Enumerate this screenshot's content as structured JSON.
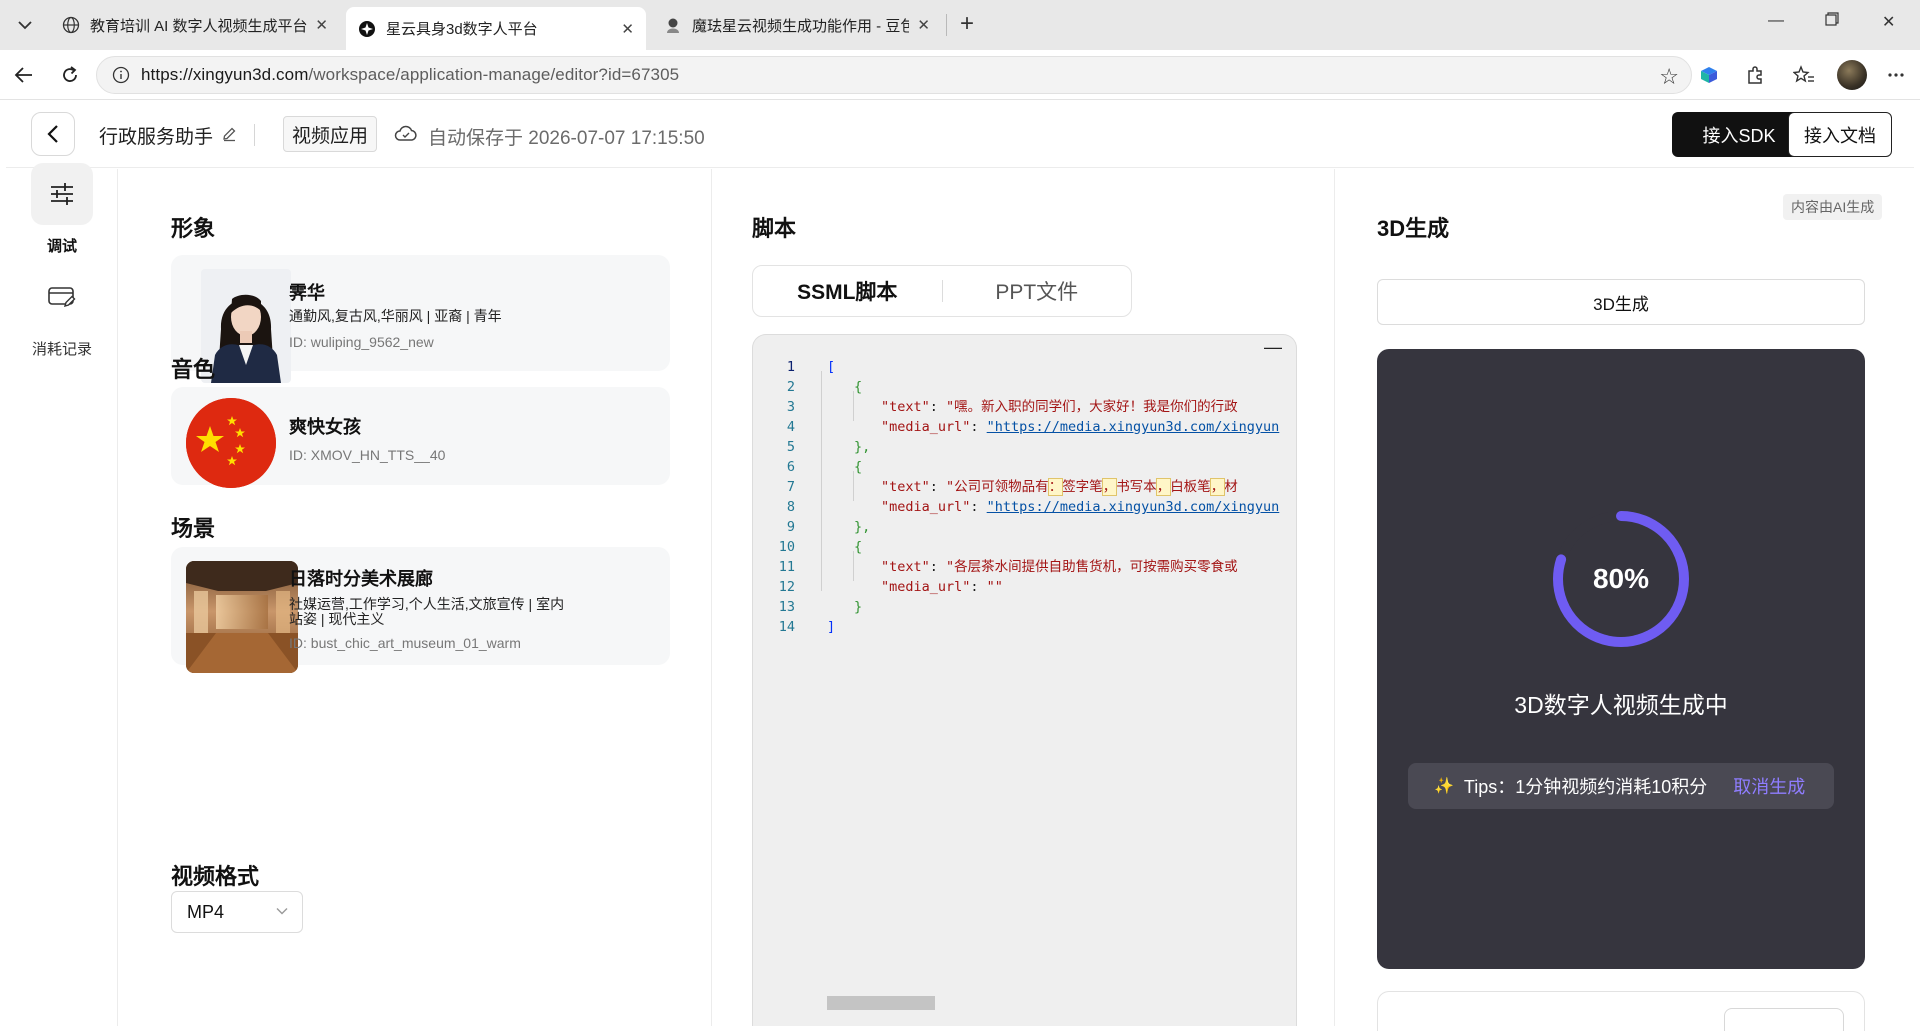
{
  "browser": {
    "tabs": [
      {
        "title": "教育培训 AI 数字人视频生成平台",
        "icon": "globe-icon",
        "active": false
      },
      {
        "title": "星云具身3d数字人平台",
        "icon": "xingyun-logo-icon",
        "active": true
      },
      {
        "title": "魔珐星云视频生成功能作用 - 豆包",
        "icon": "doubao-icon",
        "active": false
      }
    ],
    "url_host": "https://xingyun3d.com",
    "url_path": "/workspace/application-manage/editor?id=67305"
  },
  "header": {
    "app_name": "行政服务助手",
    "app_type": "视频应用",
    "autosave": "自动保存于 2026-07-07 17:15:50",
    "sdk_button": "接入SDK",
    "doc_button": "接入文档"
  },
  "rail": {
    "items": [
      {
        "label": "调试",
        "icon": "sliders-icon",
        "active": true
      },
      {
        "label": "消耗记录",
        "icon": "card-edit-icon",
        "active": false
      }
    ]
  },
  "config": {
    "avatar_section": "形象",
    "avatar": {
      "name": "霁华",
      "tags": "通勤风,复古风,华丽风 | 亚裔 | 青年",
      "id": "ID: wuliping_9562_new"
    },
    "voice_section": "音色",
    "voice": {
      "name": "爽快女孩",
      "id": "ID: XMOV_HN_TTS__40"
    },
    "scene_section": "场景",
    "scene": {
      "name": "日落时分美术展廊",
      "tags_line1": "社媒运营,工作学习,个人生活,文旅宣传 | 室内",
      "tags_line2": "站姿 | 现代主义",
      "id": "ID: bust_chic_art_museum_01_warm"
    },
    "format_section": "视频格式",
    "format_value": "MP4"
  },
  "script": {
    "title": "脚本",
    "tabs": [
      "SSML脚本",
      "PPT文件"
    ],
    "active_tab": "SSML脚本",
    "lines": [
      {
        "n": "1",
        "text": "["
      },
      {
        "n": "2",
        "text": "{"
      },
      {
        "n": "3",
        "key": "\"text\"",
        "val": "\"嘿。新入职的同学们，大家好！我是你们的行政"
      },
      {
        "n": "4",
        "key": "\"media_url\"",
        "url": "\"https://media.xingyun3d.com/xingyun"
      },
      {
        "n": "5",
        "text": "},"
      },
      {
        "n": "6",
        "text": "{"
      },
      {
        "n": "7",
        "key": "\"text\"",
        "val": "\"公司可领物品有",
        "segments": [
          "：",
          "签字笔",
          "，",
          "书写本",
          "，",
          "白板笔",
          "，",
          "材"
        ]
      },
      {
        "n": "8",
        "key": "\"media_url\"",
        "url": "\"https://media.xingyun3d.com/xingyun"
      },
      {
        "n": "9",
        "text": "},"
      },
      {
        "n": "10",
        "text": "{"
      },
      {
        "n": "11",
        "key": "\"text\"",
        "val": "\"各层茶水间提供自助售货机，可按需购买零食或"
      },
      {
        "n": "12",
        "key": "\"media_url\"",
        "val": "\"\""
      },
      {
        "n": "13",
        "text": "}"
      },
      {
        "n": "14",
        "text": "]"
      }
    ]
  },
  "generation": {
    "ai_tag": "内容由AI生成",
    "title": "3D生成",
    "bar_label": "3D生成",
    "progress": 0.8,
    "progress_text": "80%",
    "status": "3D数字人视频生成中",
    "tips": "Tips：1分钟视频约消耗10积分",
    "cancel": "取消生成",
    "accent": "#6f5cf2"
  }
}
